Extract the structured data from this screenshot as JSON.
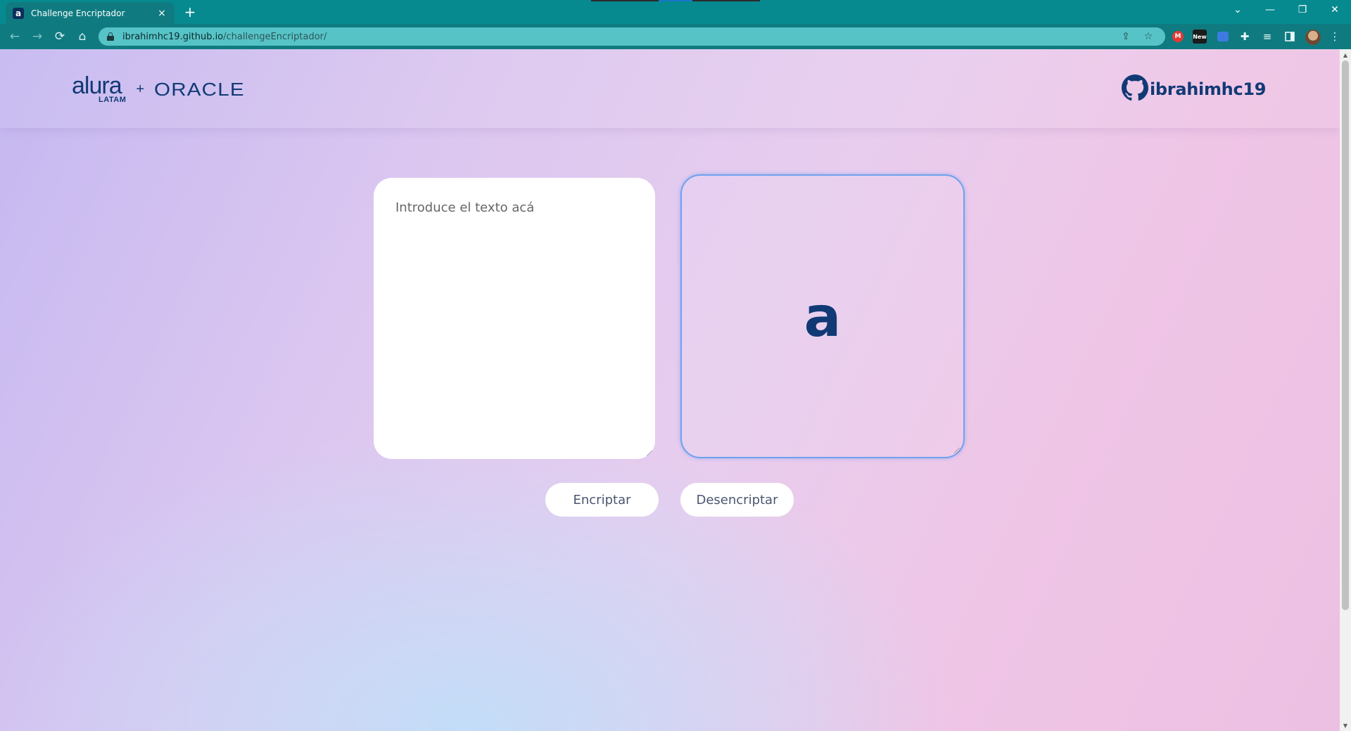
{
  "browser": {
    "tab_title": "Challenge Encriptador",
    "tab_favicon": "a",
    "tab_close": "×",
    "new_tab": "+",
    "url_host": "ibrahimhc19.github.io",
    "url_path": "/challengeEncriptador/",
    "icons": {
      "back": "←",
      "forward": "→",
      "reload": "⟳",
      "home": "⌂",
      "share": "⇪",
      "star": "☆",
      "extensions": "✚",
      "menu": "⋮",
      "minimize": "—",
      "restore": "❐",
      "close": "✕",
      "tab_search": "⌄"
    },
    "extensions": [
      "M",
      "New",
      "",
      "≡"
    ]
  },
  "header": {
    "logo_alura": "alura",
    "logo_latam": "LATAM",
    "logo_plus": "+",
    "logo_oracle": "ORACLE",
    "github_user": "ibrahimhc19"
  },
  "main": {
    "input_placeholder": "Introduce el texto acá",
    "output_logo": "a",
    "encrypt_label": "Encriptar",
    "decrypt_label": "Desencriptar"
  },
  "colors": {
    "brand_blue": "#113a75",
    "chrome_teal": "#0f7b80",
    "output_border": "#6fa2ee"
  }
}
